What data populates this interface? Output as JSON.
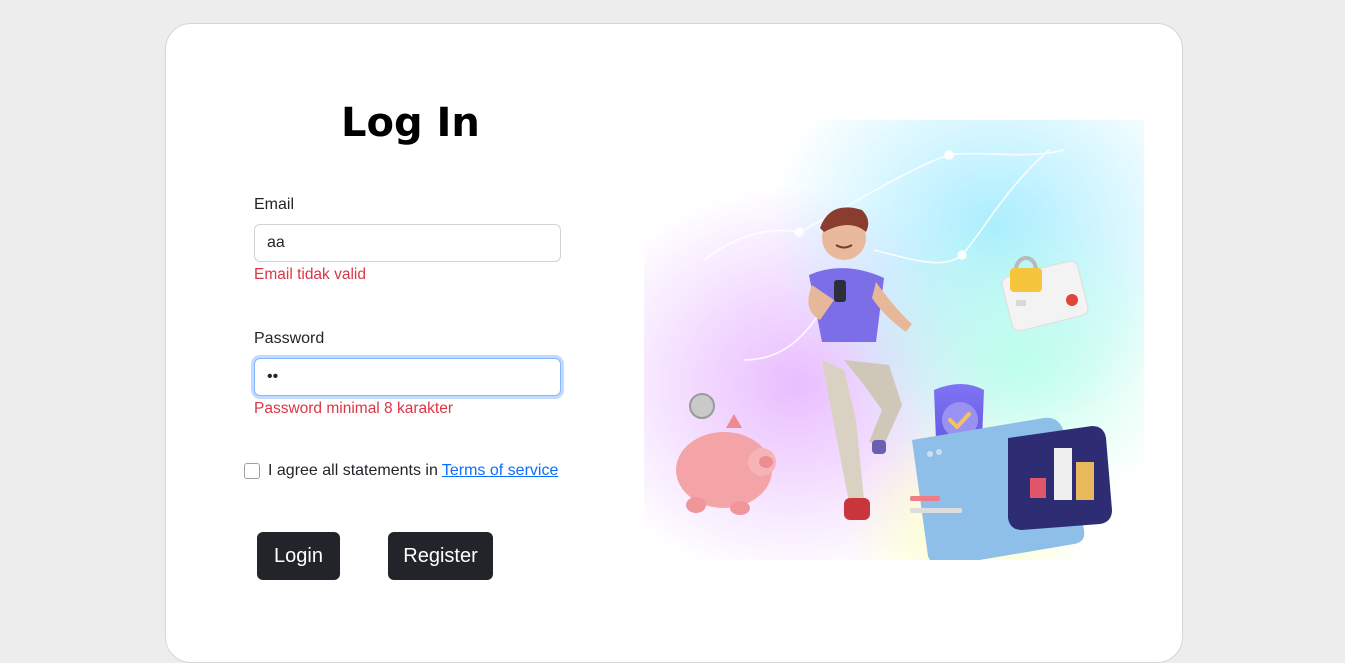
{
  "page": {
    "title": "Log In"
  },
  "form": {
    "email": {
      "label": "Email",
      "value": "aa",
      "error": "Email tidak valid"
    },
    "password": {
      "label": "Password",
      "value": "••",
      "error": "Password minimal 8 karakter"
    },
    "agree": {
      "text": "I agree all statements in",
      "link": "Terms of service",
      "checked": false
    },
    "buttons": {
      "login": "Login",
      "register": "Register"
    }
  },
  "colors": {
    "error": "#dc3545",
    "button": "#212529",
    "link": "#0d6efd",
    "focus": "#86b7fe"
  }
}
